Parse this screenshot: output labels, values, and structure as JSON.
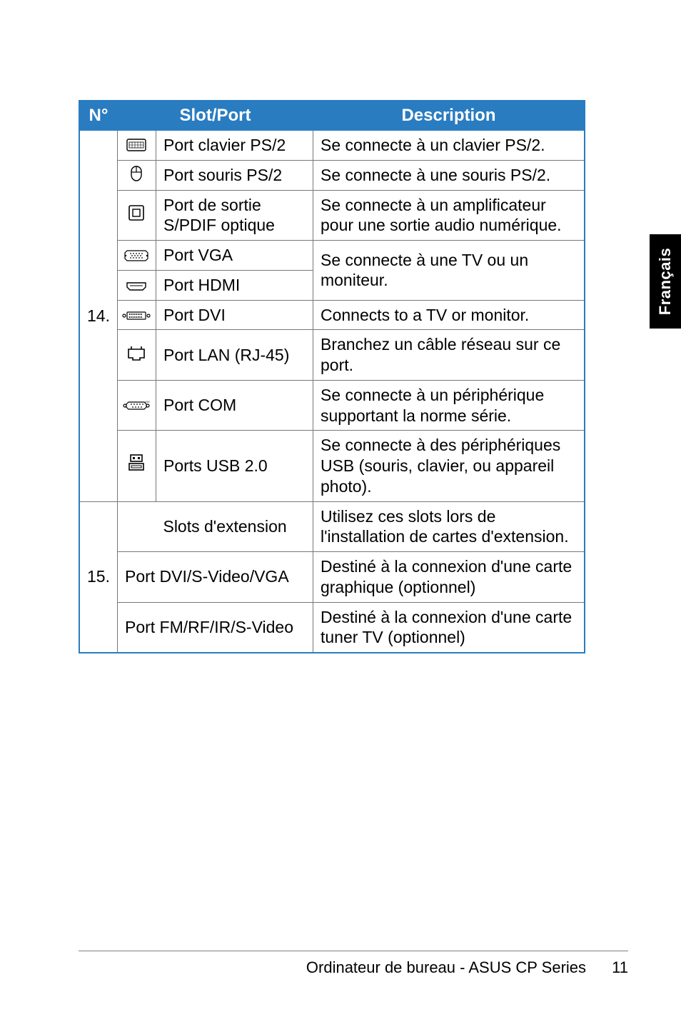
{
  "side_tab": "Français",
  "table": {
    "headers": {
      "num": "N°",
      "slot": "Slot/Port",
      "desc": "Description"
    },
    "group14": {
      "num": "14.",
      "rows": [
        {
          "icon": "keyboard-icon",
          "slot": "Port clavier PS/2",
          "desc": "Se connecte à un clavier PS/2."
        },
        {
          "icon": "mouse-icon",
          "slot": "Port souris PS/2",
          "desc": "Se connecte à une souris PS/2."
        },
        {
          "icon": "spdif-icon",
          "slot": "Port de sortie S/PDIF optique",
          "desc": "Se connecte à un amplificateur pour une sortie audio numérique."
        },
        {
          "icon": "vga-icon",
          "slot": "Port VGA",
          "desc_merged": "Se connecte à une TV ou un moniteur."
        },
        {
          "icon": "hdmi-icon",
          "slot": "Port HDMI"
        },
        {
          "icon": "dvi-icon",
          "slot": "Port DVI",
          "desc": "Connects to a TV or monitor."
        },
        {
          "icon": "lan-icon",
          "slot": "Port LAN (RJ-45)",
          "desc": "Branchez un câble réseau sur ce port."
        },
        {
          "icon": "com-icon",
          "slot": "Port COM",
          "desc": "Se connecte à un périphérique supportant la norme série."
        },
        {
          "icon": "usb-icon",
          "slot": "Ports USB 2.0",
          "desc": "Se connecte à des périphériques USB (souris, clavier, ou appareil photo)."
        }
      ]
    },
    "group15": {
      "num": "15.",
      "rows": [
        {
          "slot": "Slots d'extension",
          "desc": "Utilisez ces slots lors de l'installation de cartes d'extension."
        },
        {
          "slot": "Port DVI/S-Video/VGA",
          "desc": "Destiné à la connexion d'une carte graphique (optionnel)"
        },
        {
          "slot": "Port FM/RF/IR/S-Video",
          "desc": "Destiné à la connexion d'une carte tuner TV (optionnel)"
        }
      ]
    }
  },
  "footer": {
    "text": "Ordinateur de bureau - ASUS CP Series",
    "page": "11"
  }
}
